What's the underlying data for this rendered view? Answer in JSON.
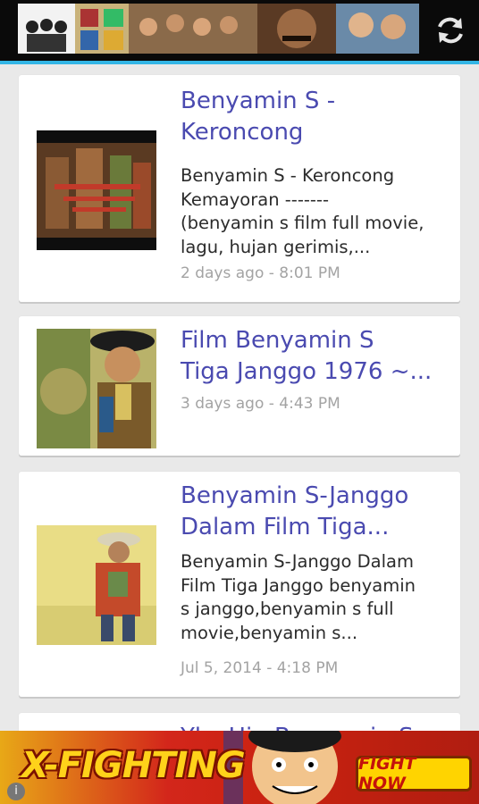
{
  "header": {
    "banner_icon": "photo-collage-banner",
    "refresh_icon": "refresh-icon"
  },
  "accent_color": "#33b5e5",
  "title_color": "#4a4ab0",
  "feed": {
    "items": [
      {
        "title": "Benyamin S -\nKeroncong",
        "description": "Benyamin S - Keroncong\nKemayoran -------\n(benyamin s film full movie,\nlagu, hujan gerimis,...",
        "time": "2 days ago - 8:01 PM"
      },
      {
        "title": "Film Benyamin S\nTiga Janggo 1976 ~...",
        "description": "",
        "time": "3 days ago - 4:43 PM"
      },
      {
        "title": "Benyamin S-Janggo\nDalam Film Tiga...",
        "description": "Benyamin S-Janggo Dalam\nFilm Tiga Janggo benyamin\ns janggo,benyamin s full\nmovie,benyamin s...",
        "time": "Jul 5, 2014 - 4:18 PM"
      },
      {
        "title": "Ykc Hiu Benyamin S",
        "description": "",
        "time": ""
      }
    ]
  },
  "ad": {
    "logo_text": "X-FIGHTING",
    "button_label": "FIGHT NOW",
    "info_label": "i"
  }
}
